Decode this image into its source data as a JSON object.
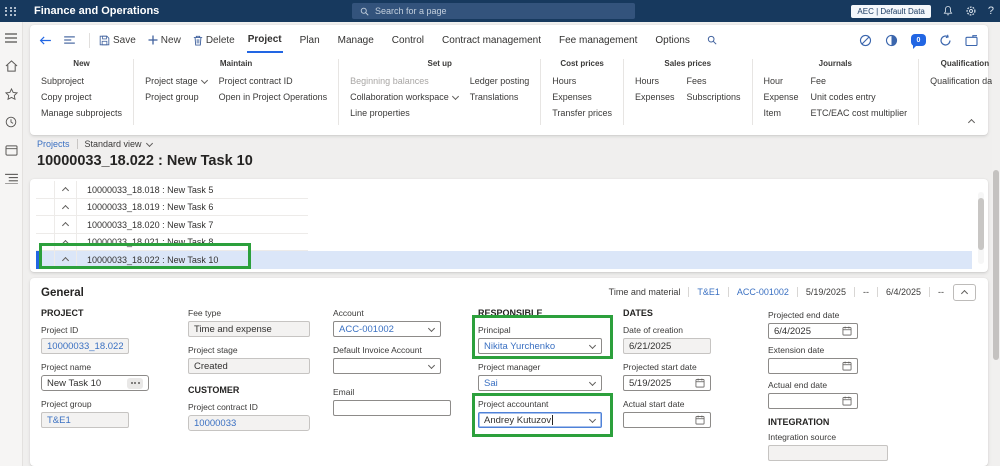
{
  "topbar": {
    "app_title": "Finance and Operations",
    "search_placeholder": "Search for a page",
    "environment": "AEC | Default Data",
    "help": "?",
    "chat_badge": "0"
  },
  "toolbar": {
    "save": "Save",
    "new": "New",
    "delete": "Delete"
  },
  "tabs": [
    "Project",
    "Plan",
    "Manage",
    "Control",
    "Contract management",
    "Fee management",
    "Options"
  ],
  "ribbon": {
    "new": {
      "title": "New",
      "items": [
        "Subproject",
        "Copy project",
        "Manage subprojects"
      ]
    },
    "maintain": {
      "title": "Maintain",
      "col1": [
        "Project stage",
        "Project group"
      ],
      "col2": [
        "Project contract ID",
        "Open in Project Operations"
      ]
    },
    "setup": {
      "title": "Set up",
      "col1": [
        "Beginning balances",
        "Collaboration workspace",
        "Line properties"
      ],
      "col2": [
        "Ledger posting",
        "Translations"
      ]
    },
    "cost": {
      "title": "Cost prices",
      "items": [
        "Hours",
        "Expenses",
        "Transfer prices"
      ]
    },
    "sales": {
      "title": "Sales prices",
      "col1": [
        "Hours",
        "Expenses"
      ],
      "col2": [
        "Fees",
        "Subscriptions"
      ]
    },
    "journals": {
      "title": "Journals",
      "col1": [
        "Hour",
        "Expense",
        "Item"
      ],
      "col2": [
        "Fee",
        "Unit codes entry",
        "ETC/EAC cost multiplier"
      ]
    },
    "qualification": {
      "title": "Qualification",
      "items": [
        "Qualification data"
      ]
    }
  },
  "page": {
    "breadcrumb": "Projects",
    "view": "Standard view",
    "title": "10000033_18.022 : New Task 10"
  },
  "grid": {
    "rows": [
      "10000033_18.018 : New Task 5",
      "10000033_18.019 : New Task 6",
      "10000033_18.020 : New Task 7",
      "10000033_18.021 : New Task 8",
      "10000033_18.022 : New Task 10"
    ],
    "selected_index": 4
  },
  "general": {
    "title": "General",
    "summary": [
      "Time and material",
      "T&E1",
      "ACC-001002",
      "5/19/2025",
      "--",
      "6/4/2025",
      "--"
    ],
    "sections": {
      "project": "PROJECT",
      "customer": "CUSTOMER",
      "responsible": "RESPONSIBLE",
      "dates": "DATES",
      "integration": "INTEGRATION"
    },
    "fields": {
      "project_id": {
        "label": "Project ID",
        "value": "10000033_18.022"
      },
      "project_name": {
        "label": "Project name",
        "value": "New Task 10"
      },
      "project_group": {
        "label": "Project group",
        "value": "T&E1"
      },
      "fee_type": {
        "label": "Fee type",
        "value": "Time and expense"
      },
      "project_stage": {
        "label": "Project stage",
        "value": "Created"
      },
      "project_contract_id": {
        "label": "Project contract ID",
        "value": "10000033"
      },
      "account": {
        "label": "Account",
        "value": "ACC-001002"
      },
      "default_invoice_account": {
        "label": "Default Invoice Account",
        "value": ""
      },
      "email": {
        "label": "Email",
        "value": ""
      },
      "principal": {
        "label": "Principal",
        "value": "Nikita Yurchenko"
      },
      "project_manager": {
        "label": "Project manager",
        "value": "Sai"
      },
      "project_accountant": {
        "label": "Project accountant",
        "value": "Andrey Kutuzov"
      },
      "date_of_creation": {
        "label": "Date of creation",
        "value": "6/21/2025"
      },
      "projected_start_date": {
        "label": "Projected start date",
        "value": "5/19/2025"
      },
      "actual_start_date": {
        "label": "Actual start date",
        "value": ""
      },
      "projected_end_date": {
        "label": "Projected end date",
        "value": "6/4/2025"
      },
      "extension_date": {
        "label": "Extension date",
        "value": ""
      },
      "actual_end_date": {
        "label": "Actual end date",
        "value": ""
      },
      "integration_source": {
        "label": "Integration source",
        "value": ""
      }
    }
  },
  "colors": {
    "topbar": "#17395e",
    "accent": "#2266E3",
    "link": "#3a70c2",
    "annotation_green": "#2ca03c",
    "selected_row": "#dbe6f8"
  }
}
